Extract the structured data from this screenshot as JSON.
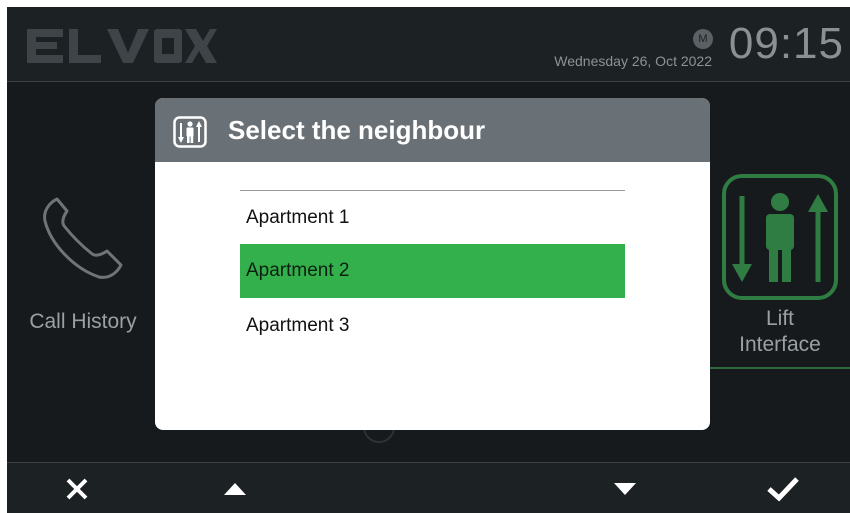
{
  "brand": {
    "logo_text": "ELVOX"
  },
  "status": {
    "badge": "M",
    "date": "Wednesday 26, Oct 2022",
    "time": "09:15"
  },
  "tiles": {
    "call_history": {
      "label": "Call History",
      "icon": "phone-icon"
    },
    "lift_interface": {
      "label_line1": "Lift",
      "label_line2": "Interface",
      "icon": "lift-icon"
    }
  },
  "dialog": {
    "title": "Select the neighbour",
    "icon": "lift-icon",
    "items": [
      {
        "label": "Apartment 1",
        "selected": false
      },
      {
        "label": "Apartment 2",
        "selected": true
      },
      {
        "label": "Apartment 3",
        "selected": false
      }
    ]
  },
  "bottom_bar": {
    "buttons": [
      {
        "icon": "close-icon"
      },
      {
        "icon": "arrow-up-icon"
      },
      {
        "icon": "arrow-down-icon"
      },
      {
        "icon": "check-icon"
      }
    ]
  },
  "colors": {
    "selection": "#33b04b",
    "dialog_header": "#6a7176",
    "background": "#161a1d",
    "accent_green": "#2e6b3c"
  }
}
